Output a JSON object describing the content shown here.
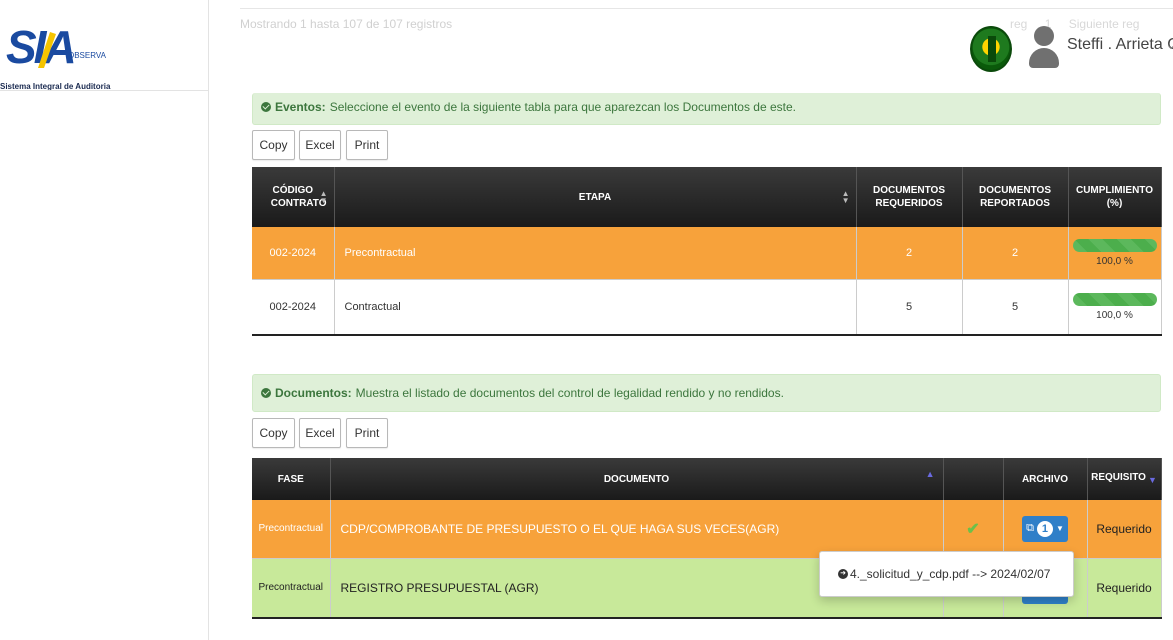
{
  "logo": {
    "brand": "SIA",
    "observa": "OBSERVA",
    "subtitle": "Sistema Integral de Auditoria"
  },
  "header": {
    "ghost_info": "Mostrando 1 hasta 107 de 107 registros",
    "ghost_pager": [
      "reg",
      "1",
      "Siguiente reg"
    ],
    "user_name": "Steffi . Arrieta C."
  },
  "events_alert": {
    "title": "Eventos:",
    "text": "Seleccione el evento de la siguiente tabla para que aparezcan los Documentos de este."
  },
  "events_buttons": {
    "copy": "Copy",
    "excel": "Excel",
    "print": "Print"
  },
  "events_table": {
    "headers": {
      "codigo": "CÓDIGO CONTRATO",
      "etapa": "ETAPA",
      "doc_req": "DOCUMENTOS REQUERIDOS",
      "doc_rep": "DOCUMENTOS REPORTADOS",
      "cumpl": "CUMPLIMIENTO (%)"
    },
    "rows": [
      {
        "codigo": "002-2024",
        "etapa": "Precontractual",
        "requeridos": "2",
        "reportados": "2",
        "cumplimiento": "100,0 %",
        "progress": 1.0
      },
      {
        "codigo": "002-2024",
        "etapa": "Contractual",
        "requeridos": "5",
        "reportados": "5",
        "cumplimiento": "100,0 %",
        "progress": 1.0
      }
    ]
  },
  "docs_alert": {
    "title": "Documentos:",
    "text": "Muestra el listado de documentos del control de legalidad rendido y no rendidos."
  },
  "docs_buttons": {
    "copy": "Copy",
    "excel": "Excel",
    "print": "Print"
  },
  "docs_table": {
    "headers": {
      "fase": "FASE",
      "documento": "DOCUMENTO",
      "archivo": "ARCHIVO",
      "requisito": "REQUISITO"
    },
    "rows": [
      {
        "fase": "Precontractual",
        "documento": "CDP/COMPROBANTE DE PRESUPUESTO O EL QUE HAGA SUS VECES(AGR)",
        "file_count": "1",
        "requisito": "Requerido"
      },
      {
        "fase": "Precontractual",
        "documento": "REGISTRO PRESUPUESTAL (AGR)",
        "requisito": "Requerido"
      }
    ]
  },
  "file_dropdown": {
    "item": "4._solicitud_y_cdp.pdf --> 2024/02/07"
  },
  "colors": {
    "orange_row": "#f7a23b",
    "lime_row": "#c8e99a",
    "header_dark": "#1a1a1a",
    "alert_bg": "#dff0d8",
    "file_button": "#2f7fc8"
  }
}
